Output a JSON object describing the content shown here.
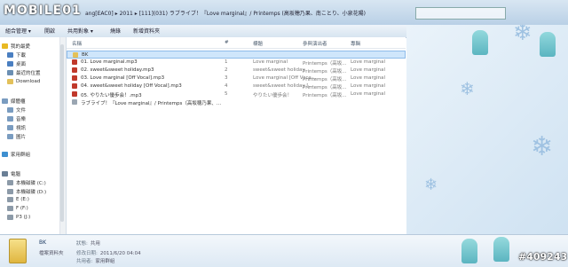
{
  "brand": {
    "logo_text": "MOBILE01",
    "watermark": "#409243"
  },
  "titlebar": {
    "path": "ang[EAC0]  ▸  2011  ▸  [111](031)  ラブライブ！『Love marginal』/ Printemps (高坂穂乃果、南ことり、小泉花陽)"
  },
  "toolbar": {
    "organize": "組合管理 ▾",
    "open": "開啟",
    "share": "共用對象 ▾",
    "burn": "燒錄",
    "newfolder": "新增資料夾"
  },
  "sidebar": {
    "items": [
      {
        "label": "我的最愛",
        "icon": "star-icon",
        "color": "#e8b923"
      },
      {
        "label": "下載",
        "icon": "download-icon",
        "color": "#4a7fc1"
      },
      {
        "label": "桌面",
        "icon": "desktop-icon",
        "color": "#4a7fc1"
      },
      {
        "label": "最近的位置",
        "icon": "recent-icon",
        "color": "#6b8fb3"
      },
      {
        "label": "Download",
        "icon": "folder-icon",
        "color": "#e3c15a"
      },
      {
        "label": "媒體櫃",
        "icon": "library-icon",
        "color": "#7a9cc0"
      },
      {
        "label": "文件",
        "icon": "documents-icon",
        "color": "#7a9cc0"
      },
      {
        "label": "音樂",
        "icon": "music-icon",
        "color": "#7a9cc0"
      },
      {
        "label": "視訊",
        "icon": "video-icon",
        "color": "#7a9cc0"
      },
      {
        "label": "圖片",
        "icon": "pictures-icon",
        "color": "#7a9cc0"
      },
      {
        "label": "家用群組",
        "icon": "homegroup-icon",
        "color": "#3e8fd0"
      },
      {
        "label": "電腦",
        "icon": "computer-icon",
        "color": "#6a7f95"
      },
      {
        "label": "本機磁碟 (C:)",
        "icon": "drive-icon",
        "color": "#8c9aa8"
      },
      {
        "label": "本機磁碟 (D:)",
        "icon": "drive-icon",
        "color": "#8c9aa8"
      },
      {
        "label": "E (E:)",
        "icon": "drive-icon",
        "color": "#8c9aa8"
      },
      {
        "label": "F (F:)",
        "icon": "drive-icon",
        "color": "#8c9aa8"
      },
      {
        "label": "P3 (J:)",
        "icon": "drive-icon",
        "color": "#8c9aa8"
      }
    ]
  },
  "list": {
    "headers": {
      "name": "名稱",
      "num": "#",
      "title": "標題",
      "artist": "參與演出者",
      "album": "專輯"
    },
    "rows": [
      {
        "name": "BK",
        "num": "",
        "title": "",
        "artist": "",
        "album": "",
        "icon": "folder-icon",
        "color": "#e3c15a"
      },
      {
        "name": "01. Love marginal.mp3",
        "num": "1",
        "title": "Love marginal",
        "artist": "Printemps（高坂...",
        "album": "Love marginal",
        "icon": "audio-file-icon",
        "color": "#c0392b"
      },
      {
        "name": "02. sweet&sweet holiday.mp3",
        "num": "2",
        "title": "sweet&sweet holiday",
        "artist": "Printemps（高坂...",
        "album": "Love marginal",
        "icon": "audio-file-icon",
        "color": "#c0392b"
      },
      {
        "name": "03. Love marginal [Off Vocal].mp3",
        "num": "3",
        "title": "Love marginal [Off Voca...",
        "artist": "Printemps（高坂...",
        "album": "Love marginal",
        "icon": "audio-file-icon",
        "color": "#c0392b"
      },
      {
        "name": "04. sweet&sweet holiday [Off Vocal].mp3",
        "num": "4",
        "title": "sweet&sweet holiday [...",
        "artist": "Printemps（高坂...",
        "album": "Love marginal",
        "icon": "audio-file-icon",
        "color": "#c0392b"
      },
      {
        "name": "05. やりたい優歩会！.mp3",
        "num": "5",
        "title": "やりたい優歩会！",
        "artist": "Printemps（高坂...",
        "album": "Love marginal",
        "icon": "audio-file-icon",
        "color": "#c0392b"
      },
      {
        "name": "ラブライブ！『Love marginal』/ Printemps（高坂穂乃果、...",
        "num": "",
        "title": "",
        "artist": "",
        "album": "",
        "icon": "text-file-icon",
        "color": "#9aa6b2"
      }
    ]
  },
  "details": {
    "name": "BK",
    "type_label": "檔案資料夾",
    "state_label": "狀態:",
    "state_value": "共用",
    "modified_label": "修改日期:",
    "modified_value": "2011/6/20 04:04",
    "shared_label": "共用者:",
    "shared_value": "家用群組"
  }
}
